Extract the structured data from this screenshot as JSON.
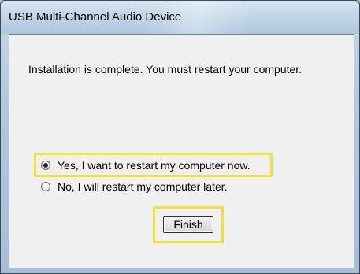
{
  "window": {
    "title": "USB Multi-Channel Audio Device"
  },
  "dialog": {
    "message": "Installation is complete. You must restart your computer.",
    "options": [
      {
        "label": "Yes, I want to restart my computer now.",
        "selected": true
      },
      {
        "label": "No, I will restart my computer later.",
        "selected": false
      }
    ],
    "finish_label": "Finish"
  },
  "colors": {
    "highlight": "#f2e13a"
  }
}
